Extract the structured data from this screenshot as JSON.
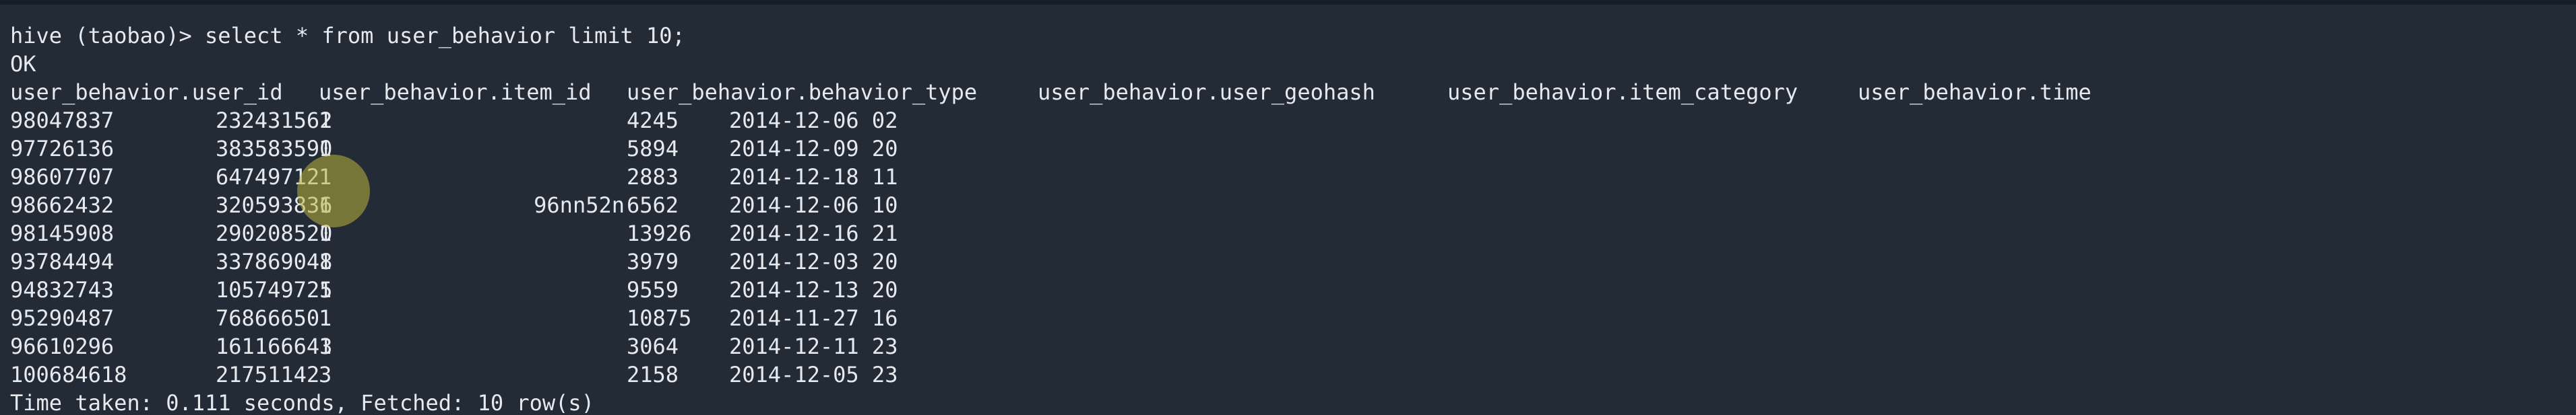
{
  "terminal": {
    "command_line": "hive (taobao)> select * from user_behavior limit 10;",
    "ok_line": "OK",
    "headers": [
      "user_behavior.user_id",
      "user_behavior.item_id",
      "user_behavior.behavior_type",
      "user_behavior.user_geohash",
      "user_behavior.item_category",
      "user_behavior.time"
    ],
    "rows": [
      {
        "user_id": "98047837",
        "item_id": "232431562",
        "behavior_type": "1",
        "user_geohash": "",
        "item_category": "4245",
        "time": "2014-12-06 02"
      },
      {
        "user_id": "97726136",
        "item_id": "383583590",
        "behavior_type": "1",
        "user_geohash": "",
        "item_category": "5894",
        "time": "2014-12-09 20"
      },
      {
        "user_id": "98607707",
        "item_id": "64749712",
        "behavior_type": "1",
        "user_geohash": "",
        "item_category": "2883",
        "time": "2014-12-18 11"
      },
      {
        "user_id": "98662432",
        "item_id": "320593836",
        "behavior_type": "1",
        "user_geohash": "96nn52n",
        "item_category": "6562",
        "time": "2014-12-06 10"
      },
      {
        "user_id": "98145908",
        "item_id": "290208520",
        "behavior_type": "1",
        "user_geohash": "",
        "item_category": "13926",
        "time": "2014-12-16 21"
      },
      {
        "user_id": "93784494",
        "item_id": "337869048",
        "behavior_type": "1",
        "user_geohash": "",
        "item_category": "3979",
        "time": "2014-12-03 20"
      },
      {
        "user_id": "94832743",
        "item_id": "105749725",
        "behavior_type": "1",
        "user_geohash": "",
        "item_category": "9559",
        "time": "2014-12-13 20"
      },
      {
        "user_id": "95290487",
        "item_id": "76866650",
        "behavior_type": "1",
        "user_geohash": "",
        "item_category": "10875",
        "time": "2014-11-27 16"
      },
      {
        "user_id": "96610296",
        "item_id": "161166643",
        "behavior_type": "1",
        "user_geohash": "",
        "item_category": "3064",
        "time": "2014-12-11 23"
      },
      {
        "user_id": "100684618",
        "item_id": "21751142",
        "behavior_type": "3",
        "user_geohash": "",
        "item_category": "2158",
        "time": "2014-12-05 23"
      }
    ],
    "footer_line": "Time taken: 0.111 seconds, Fetched: 10 row(s)",
    "colors": {
      "background": "#232b37",
      "text": "#e6e9ee",
      "cursor_highlight": "#beb43c"
    }
  }
}
